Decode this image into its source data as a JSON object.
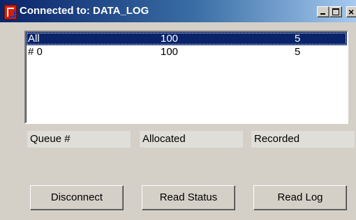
{
  "window": {
    "title": "Connected to: DATA_LOG",
    "close_glyph": "×"
  },
  "list": {
    "rows": [
      {
        "queue": "All",
        "allocated": "100",
        "recorded": "5",
        "selected": true
      },
      {
        "queue": "# 0",
        "allocated": "100",
        "recorded": "5",
        "selected": false
      }
    ]
  },
  "columns": {
    "queue": "Queue #",
    "allocated": "Allocated",
    "recorded": "Recorded"
  },
  "buttons": {
    "disconnect": "Disconnect",
    "read_status": "Read Status",
    "read_log": "Read Log"
  },
  "icons": {
    "app": "app-logo-icon",
    "minimize": "minimize-icon",
    "maximize": "maximize-icon",
    "close": "close-icon"
  },
  "colors": {
    "titlebar": "#0a246a",
    "selection": "#0a246a",
    "face": "#d4d0c8"
  }
}
